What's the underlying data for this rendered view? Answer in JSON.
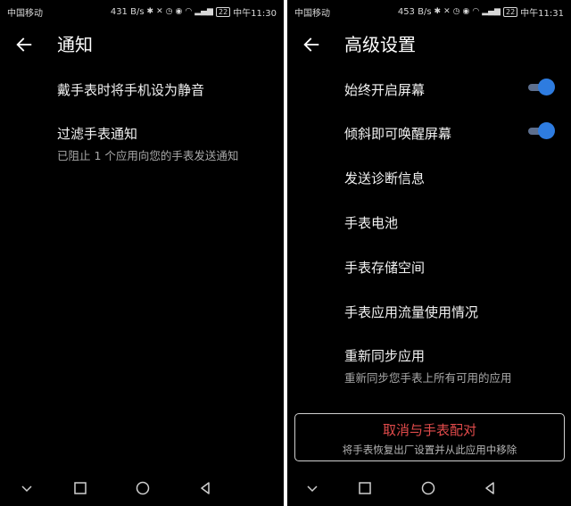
{
  "left": {
    "status": {
      "carrier": "中国移动",
      "speed": "431 B/s",
      "battery": "22",
      "time": "中午11:30"
    },
    "title": "通知",
    "items": [
      {
        "label": "戴手表时将手机设为静音"
      },
      {
        "label": "过滤手表通知",
        "sub": "已阻止 1 个应用向您的手表发送通知"
      }
    ]
  },
  "right": {
    "status": {
      "carrier": "中国移动",
      "speed": "453 B/s",
      "battery": "22",
      "time": "中午11:31"
    },
    "title": "高级设置",
    "items": [
      {
        "label": "始终开启屏幕",
        "toggle": true
      },
      {
        "label": "倾斜即可唤醒屏幕",
        "toggle": true
      },
      {
        "label": "发送诊断信息"
      },
      {
        "label": "手表电池"
      },
      {
        "label": "手表存储空间"
      },
      {
        "label": "手表应用流量使用情况"
      },
      {
        "label": "重新同步应用",
        "sub": "重新同步您手表上所有可用的应用"
      }
    ],
    "unpair": {
      "title": "取消与手表配对",
      "sub": "将手表恢复出厂设置并从此应用中移除"
    }
  },
  "colors": {
    "background": "#000000",
    "toggle_accent": "#2e7ce0",
    "danger": "#e24b4b"
  },
  "icons": [
    "back-arrow-icon",
    "bluetooth-icon",
    "mute-icon",
    "alarm-icon",
    "eye-icon",
    "wifi-icon",
    "signal-icon",
    "nav-down-icon",
    "nav-recents-icon",
    "nav-home-icon",
    "nav-back-icon"
  ]
}
